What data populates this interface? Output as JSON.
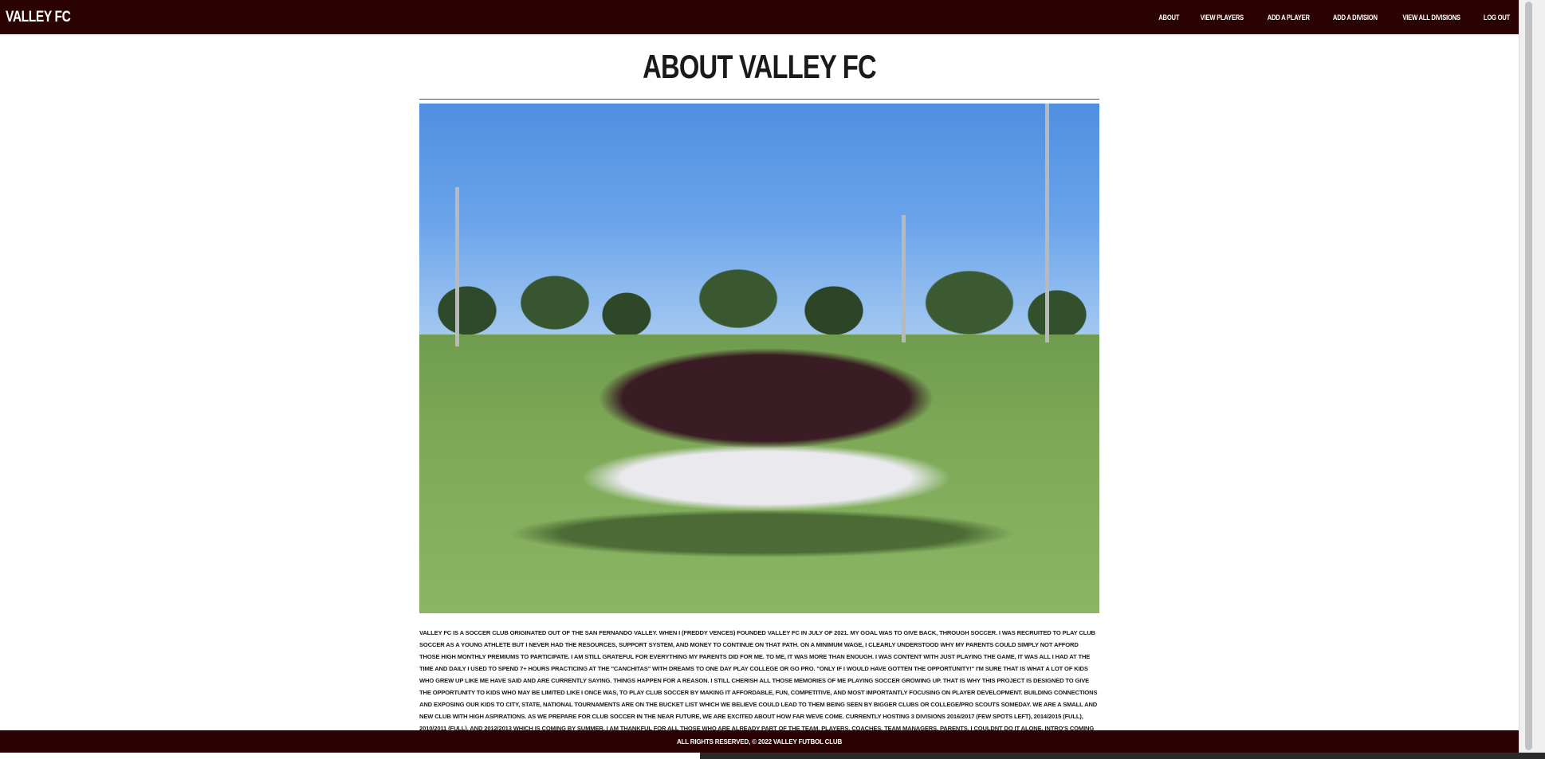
{
  "navbar": {
    "brand": "VALLEY FC",
    "links": [
      "ABOUT",
      "VIEW PLAYERS",
      "ADD A PLAYER",
      "ADD A DIVISION",
      "VIEW ALL DIVISIONS",
      "LOG OUT"
    ]
  },
  "main": {
    "title": "ABOUT VALLEY FC",
    "photo_label": "team-photo",
    "about_text": "VALLEY FC IS A SOCCER CLUB ORIGINATED OUT OF THE SAN FERNANDO VALLEY. WHEN I (FREDDY VENCES) FOUNDED VALLEY FC IN JULY OF 2021. MY GOAL WAS TO GIVE BACK, THROUGH SOCCER. I WAS RECRUITED TO PLAY CLUB SOCCER AS A YOUNG ATHLETE BUT I NEVER HAD THE RESOURCES, SUPPORT SYSTEM, AND MONEY TO CONTINUE ON THAT PATH. ON A MINIMUM WAGE, I CLEARLY UNDERSTOOD WHY MY PARENTS COULD SIMPLY NOT AFFORD THOSE HIGH MONTHLY PREMIUMS TO PARTICIPATE. I AM STILL GRATEFUL FOR EVERYTHING MY PARENTS DID FOR ME. TO ME, IT WAS MORE THAN ENOUGH. I WAS CONTENT WITH JUST PLAYING THE GAME, IT WAS ALL I HAD AT THE TIME AND DAILY I USED TO SPEND 7+ HOURS PRACTICING AT THE \"CANCHITAS\" WITH DREAMS TO ONE DAY PLAY COLLEGE OR GO PRO. \"ONLY IF I WOULD HAVE GOTTEN THE OPPORTUNITY!\" I'M SURE THAT IS WHAT A LOT OF KIDS WHO GREW UP LIKE ME HAVE SAID AND ARE CURRENTLY SAYING. THINGS HAPPEN FOR A REASON. I STILL CHERISH ALL THOSE MEMORIES OF ME PLAYING SOCCER GROWING UP. THAT IS WHY THIS PROJECT IS DESIGNED TO GIVE THE OPPORTUNITY TO KIDS WHO MAY BE LIMITED LIKE I ONCE WAS, TO PLAY CLUB SOCCER BY MAKING IT AFFORDABLE, FUN, COMPETITIVE, AND MOST IMPORTANTLY FOCUSING ON PLAYER DEVELOPMENT. BUILDING CONNECTIONS AND EXPOSING OUR KIDS TO CITY, STATE, NATIONAL TOURNAMENTS ARE ON THE BUCKET LIST WHICH WE BELIEVE COULD LEAD TO THEM BEING SEEN BY BIGGER CLUBS OR COLLEGE/PRO SCOUTS SOMEDAY. WE ARE A SMALL AND NEW CLUB WITH HIGH ASPIRATIONS. AS WE PREPARE FOR CLUB SOCCER IN THE NEAR FUTURE, WE ARE EXCITED ABOUT HOW FAR WEVE COME. CURRENTLY HOSTING 3 DIVISIONS 2016/2017 (FEW SPOTS LEFT), 2014/2015 (FULL), 2010/2011 (FULL), AND 2012/2013 WHICH IS COMING BY SUMMER. I AM THANKFUL FOR ALL THOSE WHO ARE ALREADY PART OF THE TEAM. PLAYERS, COACHES, TEAM MANAGERS, PARENTS, I COULDNT DO IT ALONE. INTRO'S COMING SOON! THANKS FOR JOINING US AND WELCOME ONCE AGAIN! BASED OUT OF THE SAN FERNANDO VALLEY."
  },
  "footer": {
    "text": "ALL RIGHTS RESERVED, © 2022 VALLEY FUTBOL CLUB"
  },
  "colors": {
    "brand_bg": "#2b0303",
    "text": "#1a1a1a"
  }
}
